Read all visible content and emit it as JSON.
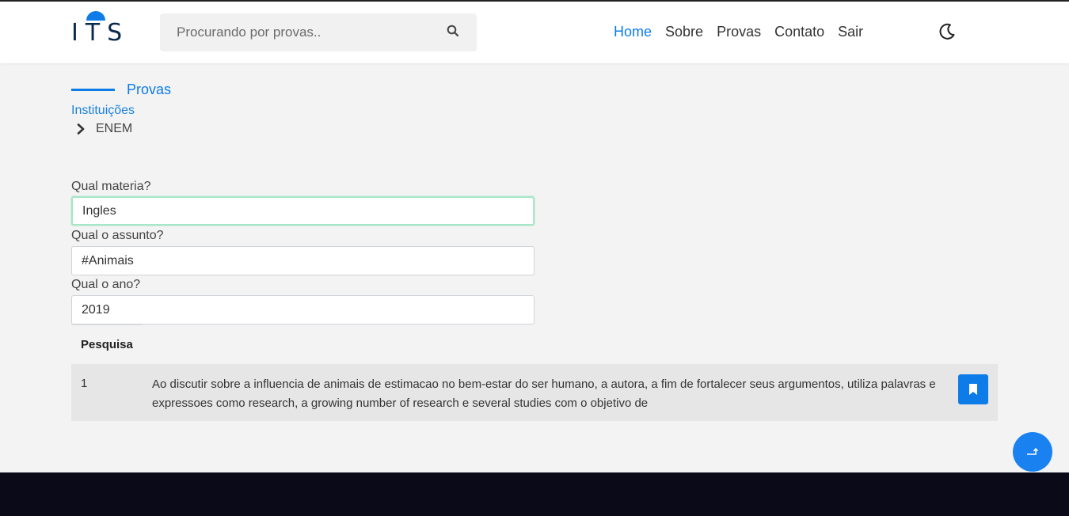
{
  "brand": {
    "logo_text": "ITS"
  },
  "search": {
    "placeholder": "Procurando por provas..",
    "value": ""
  },
  "nav": {
    "items": [
      {
        "label": "Home",
        "active": true
      },
      {
        "label": "Sobre",
        "active": false
      },
      {
        "label": "Provas",
        "active": false
      },
      {
        "label": "Contato",
        "active": false
      },
      {
        "label": "Sair",
        "active": false
      }
    ]
  },
  "icons": {
    "search": "search-icon",
    "theme": "moon-icon",
    "bookmark": "bookmark-icon",
    "scroll": "arrow-up-icon",
    "chevron": "chevron-right-icon"
  },
  "colors": {
    "accent": "#0d7ce8",
    "footer": "#0b0a18",
    "focus_border": "#a8e6c8"
  },
  "page": {
    "section_title": "Provas",
    "breadcrumb": {
      "institution_link": "Instituições",
      "current": "ENEM"
    }
  },
  "form": {
    "materia": {
      "label": "Qual materia?",
      "value": "Ingles"
    },
    "assunto": {
      "label": "Qual o assunto?",
      "value": "#Animais"
    },
    "ano": {
      "label": "Qual o ano?",
      "value": "2019"
    }
  },
  "results": {
    "header": "Pesquisa",
    "rows": [
      {
        "number": "1",
        "text": "Ao discutir sobre a influencia de animais de estimacao no bem-estar do ser humano, a autora, a fim de fortalecer seus argumentos, utiliza palavras e expressoes como research, a growing number of research e several studies com o objetivo de"
      }
    ]
  }
}
